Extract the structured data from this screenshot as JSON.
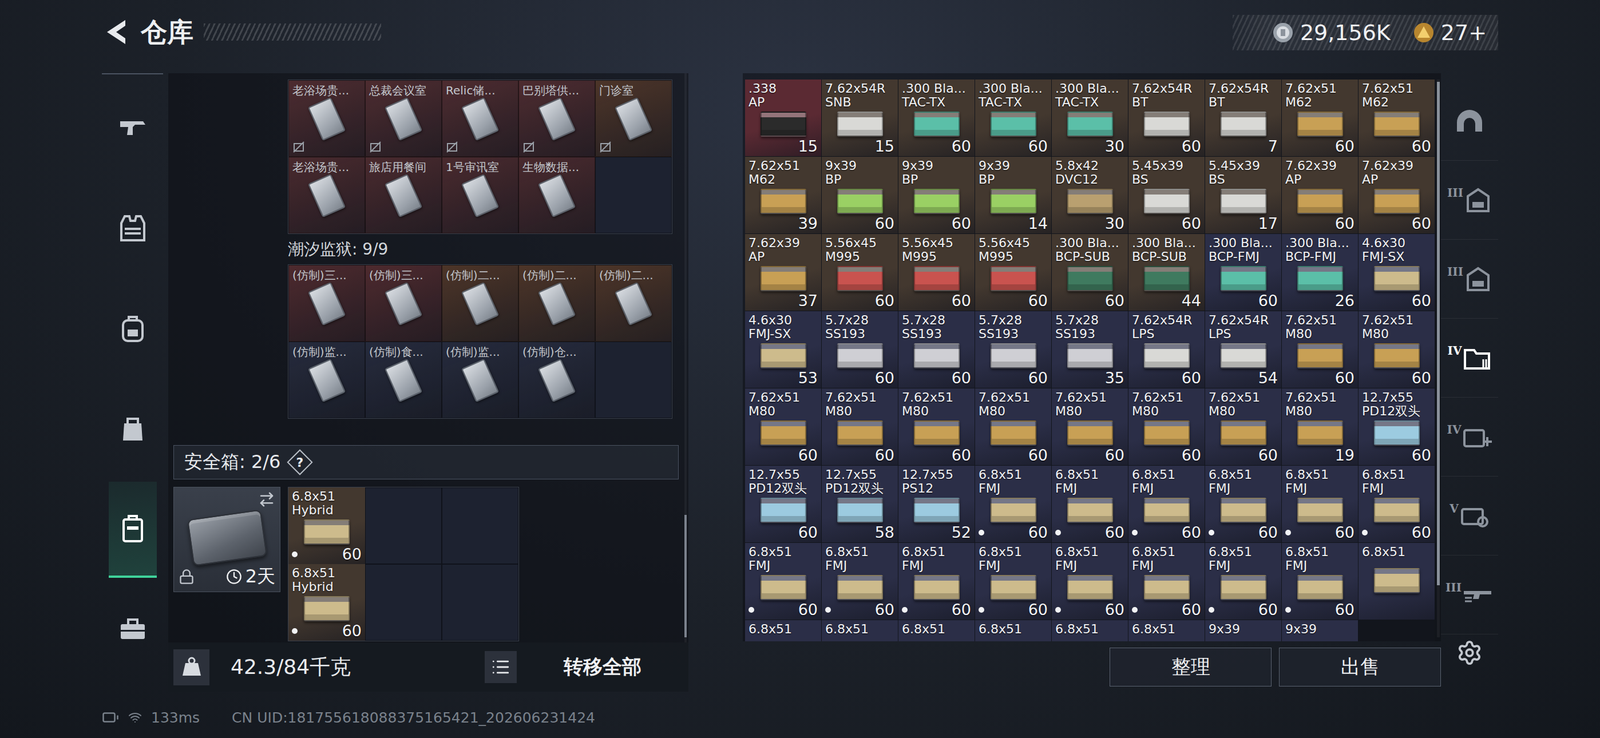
{
  "header": {
    "title": "仓库"
  },
  "currency": [
    {
      "kind": "silver",
      "value": "29,156K"
    },
    {
      "kind": "gold",
      "value": "27+"
    }
  ],
  "sidebar": {
    "items": [
      {
        "kind": "weapon",
        "selected": false
      },
      {
        "kind": "armor",
        "selected": false
      },
      {
        "kind": "backpack",
        "selected": false
      },
      {
        "kind": "pouch",
        "selected": false
      },
      {
        "kind": "case",
        "selected": true
      },
      {
        "kind": "toolbox",
        "selected": false
      }
    ]
  },
  "key_grid": {
    "cards": [
      {
        "label": "老浴场贵...",
        "color": "#4e2c30",
        "uninsured": true
      },
      {
        "label": "总裁会议室",
        "color": "#4e2c30",
        "uninsured": true
      },
      {
        "label": "Relic储...",
        "color": "#4e2c30",
        "uninsured": true
      },
      {
        "label": "巴别塔供...",
        "color": "#4e2c30",
        "uninsured": true
      },
      {
        "label": "门诊室",
        "color": "#4d3529",
        "uninsured": true
      },
      {
        "label": "老浴场贵...",
        "color": "#4a2a2e",
        "uninsured": false
      },
      {
        "label": "旅店用餐间",
        "color": "#4a2a2e",
        "uninsured": false
      },
      {
        "label": "1号审讯室",
        "color": "#4a2a2e",
        "uninsured": false
      },
      {
        "label": "生物数据...",
        "color": "#4a2a2e",
        "uninsured": false
      }
    ]
  },
  "key_section": {
    "title": "潮汐监狱: 9/9",
    "cards": [
      {
        "label": "(仿制)三...",
        "color": "#4e2a2e",
        "uninsured": false
      },
      {
        "label": "(仿制)三...",
        "color": "#4e2a2e",
        "uninsured": false
      },
      {
        "label": "(仿制)二...",
        "color": "#4d3528",
        "uninsured": false
      },
      {
        "label": "(仿制)二...",
        "color": "#4d3528",
        "uninsured": false
      },
      {
        "label": "(仿制)二...",
        "color": "#4d3528",
        "uninsured": false
      },
      {
        "label": "(仿制)监...",
        "color": "#262b3d",
        "uninsured": false
      },
      {
        "label": "(仿制)食...",
        "color": "#262b3d",
        "uninsured": false
      },
      {
        "label": "(仿制)监...",
        "color": "#262b3d",
        "uninsured": false
      },
      {
        "label": "(仿制)仓...",
        "color": "#262b3d",
        "uninsured": false
      }
    ]
  },
  "safe_box": {
    "title": "安全箱: 2/6",
    "help": "?",
    "case": {
      "timer": "2天",
      "locked": true
    },
    "items": [
      {
        "caliber": "6.8x51",
        "type": "Hybrid",
        "count": "60",
        "color": "#43382f",
        "box": "#cdbb8c",
        "dot": true
      },
      {
        "caliber": "6.8x51",
        "type": "Hybrid",
        "count": "60",
        "color": "#43382f",
        "box": "#cdbb8c",
        "dot": true
      }
    ]
  },
  "weight": {
    "text": "42.3/84千克"
  },
  "transfer_button": "转移全部",
  "ammo": [
    {
      "caliber": ".338",
      "type": "AP",
      "count": "15",
      "color": "#5b2a33",
      "box": "#2b2b2b",
      "dot": false
    },
    {
      "caliber": "7.62x54R",
      "type": "SNB",
      "count": "15",
      "color": "#43382f",
      "box": "#d9d9d6",
      "dot": false
    },
    {
      "caliber": ".300 Bla...",
      "type": "TAC-TX",
      "count": "60",
      "color": "#43382f",
      "box": "#5bbfa8",
      "dot": false
    },
    {
      "caliber": ".300 Bla...",
      "type": "TAC-TX",
      "count": "60",
      "color": "#43382f",
      "box": "#5bbfa8",
      "dot": false
    },
    {
      "caliber": ".300 Bla...",
      "type": "TAC-TX",
      "count": "30",
      "color": "#43382f",
      "box": "#5bbfa8",
      "dot": false
    },
    {
      "caliber": "7.62x54R",
      "type": "BT",
      "count": "60",
      "color": "#43382f",
      "box": "#d9d9d6",
      "dot": false
    },
    {
      "caliber": "7.62x54R",
      "type": "BT",
      "count": "7",
      "color": "#43382f",
      "box": "#d9d9d6",
      "dot": false
    },
    {
      "caliber": "7.62x51",
      "type": "M62",
      "count": "60",
      "color": "#43382f",
      "box": "#c8a055",
      "dot": false
    },
    {
      "caliber": "7.62x51",
      "type": "M62",
      "count": "60",
      "color": "#43382f",
      "box": "#c8a055",
      "dot": false
    },
    {
      "caliber": "7.62x51",
      "type": "M62",
      "count": "39",
      "color": "#43382f",
      "box": "#c8a055",
      "dot": false
    },
    {
      "caliber": "9x39",
      "type": "BP",
      "count": "60",
      "color": "#43382f",
      "box": "#9ad064",
      "dot": false
    },
    {
      "caliber": "9x39",
      "type": "BP",
      "count": "60",
      "color": "#43382f",
      "box": "#9ad064",
      "dot": false
    },
    {
      "caliber": "9x39",
      "type": "BP",
      "count": "14",
      "color": "#43382f",
      "box": "#9ad064",
      "dot": false
    },
    {
      "caliber": "5.8x42",
      "type": "DVC12",
      "count": "30",
      "color": "#43382f",
      "box": "#b9a070",
      "dot": false
    },
    {
      "caliber": "5.45x39",
      "type": "BS",
      "count": "60",
      "color": "#43382f",
      "box": "#d9d9d6",
      "dot": false
    },
    {
      "caliber": "5.45x39",
      "type": "BS",
      "count": "17",
      "color": "#43382f",
      "box": "#d9d9d6",
      "dot": false
    },
    {
      "caliber": "7.62x39",
      "type": "AP",
      "count": "60",
      "color": "#43382f",
      "box": "#c8a055",
      "dot": false
    },
    {
      "caliber": "7.62x39",
      "type": "AP",
      "count": "60",
      "color": "#43382f",
      "box": "#c8a055",
      "dot": false
    },
    {
      "caliber": "7.62x39",
      "type": "AP",
      "count": "37",
      "color": "#43382f",
      "box": "#c8a055",
      "dot": false
    },
    {
      "caliber": "5.56x45",
      "type": "M995",
      "count": "60",
      "color": "#43382f",
      "box": "#c9534f",
      "dot": false
    },
    {
      "caliber": "5.56x45",
      "type": "M995",
      "count": "60",
      "color": "#43382f",
      "box": "#c9534f",
      "dot": false
    },
    {
      "caliber": "5.56x45",
      "type": "M995",
      "count": "60",
      "color": "#43382f",
      "box": "#c9534f",
      "dot": false
    },
    {
      "caliber": ".300 Bla...",
      "type": "BCP-SUB",
      "count": "60",
      "color": "#43382f",
      "box": "#3f7a5f",
      "dot": false
    },
    {
      "caliber": ".300 Bla...",
      "type": "BCP-SUB",
      "count": "44",
      "color": "#43382f",
      "box": "#3f7a5f",
      "dot": false
    },
    {
      "caliber": ".300 Bla...",
      "type": "BCP-FMJ",
      "count": "60",
      "color": "#2b2e47",
      "box": "#5bbfa8",
      "dot": false
    },
    {
      "caliber": ".300 Bla...",
      "type": "BCP-FMJ",
      "count": "26",
      "color": "#2b2e47",
      "box": "#5bbfa8",
      "dot": false
    },
    {
      "caliber": "4.6x30",
      "type": "FMJ-SX",
      "count": "60",
      "color": "#2b2e47",
      "box": "#cdbb8c",
      "dot": false
    },
    {
      "caliber": "4.6x30",
      "type": "FMJ-SX",
      "count": "53",
      "color": "#2b2e47",
      "box": "#cdbb8c",
      "dot": false
    },
    {
      "caliber": "5.7x28",
      "type": "SS193",
      "count": "60",
      "color": "#2b2e47",
      "box": "#cfcfd4",
      "dot": false
    },
    {
      "caliber": "5.7x28",
      "type": "SS193",
      "count": "60",
      "color": "#2b2e47",
      "box": "#cfcfd4",
      "dot": false
    },
    {
      "caliber": "5.7x28",
      "type": "SS193",
      "count": "60",
      "color": "#2b2e47",
      "box": "#cfcfd4",
      "dot": false
    },
    {
      "caliber": "5.7x28",
      "type": "SS193",
      "count": "35",
      "color": "#2b2e47",
      "box": "#cfcfd4",
      "dot": false
    },
    {
      "caliber": "7.62x54R",
      "type": "LPS",
      "count": "60",
      "color": "#2b2e47",
      "box": "#d9d9d6",
      "dot": false
    },
    {
      "caliber": "7.62x54R",
      "type": "LPS",
      "count": "54",
      "color": "#2b2e47",
      "box": "#d9d9d6",
      "dot": false
    },
    {
      "caliber": "7.62x51",
      "type": "M80",
      "count": "60",
      "color": "#2b2e47",
      "box": "#c8a055",
      "dot": false
    },
    {
      "caliber": "7.62x51",
      "type": "M80",
      "count": "60",
      "color": "#2b2e47",
      "box": "#c8a055",
      "dot": false
    },
    {
      "caliber": "7.62x51",
      "type": "M80",
      "count": "60",
      "color": "#2b2e47",
      "box": "#c8a055",
      "dot": false
    },
    {
      "caliber": "7.62x51",
      "type": "M80",
      "count": "60",
      "color": "#2b2e47",
      "box": "#c8a055",
      "dot": false
    },
    {
      "caliber": "7.62x51",
      "type": "M80",
      "count": "60",
      "color": "#2b2e47",
      "box": "#c8a055",
      "dot": false
    },
    {
      "caliber": "7.62x51",
      "type": "M80",
      "count": "60",
      "color": "#2b2e47",
      "box": "#c8a055",
      "dot": false
    },
    {
      "caliber": "7.62x51",
      "type": "M80",
      "count": "60",
      "color": "#2b2e47",
      "box": "#c8a055",
      "dot": false
    },
    {
      "caliber": "7.62x51",
      "type": "M80",
      "count": "60",
      "color": "#2b2e47",
      "box": "#c8a055",
      "dot": false
    },
    {
      "caliber": "7.62x51",
      "type": "M80",
      "count": "60",
      "color": "#2b2e47",
      "box": "#c8a055",
      "dot": false
    },
    {
      "caliber": "7.62x51",
      "type": "M80",
      "count": "19",
      "color": "#2b2e47",
      "box": "#c8a055",
      "dot": false
    },
    {
      "caliber": "12.7x55",
      "type": "PD12双头",
      "count": "60",
      "color": "#2b2e47",
      "box": "#9ccbe0",
      "dot": false
    },
    {
      "caliber": "12.7x55",
      "type": "PD12双头",
      "count": "60",
      "color": "#2b2e47",
      "box": "#9ccbe0",
      "dot": false
    },
    {
      "caliber": "12.7x55",
      "type": "PD12双头",
      "count": "58",
      "color": "#2b2e47",
      "box": "#9ccbe0",
      "dot": false
    },
    {
      "caliber": "12.7x55",
      "type": "PS12",
      "count": "52",
      "color": "#2b2e47",
      "box": "#9ccbe0",
      "dot": false
    },
    {
      "caliber": "6.8x51",
      "type": "FMJ",
      "count": "60",
      "color": "#2b2e47",
      "box": "#cdbb8c",
      "dot": true
    },
    {
      "caliber": "6.8x51",
      "type": "FMJ",
      "count": "60",
      "color": "#2b2e47",
      "box": "#cdbb8c",
      "dot": true
    },
    {
      "caliber": "6.8x51",
      "type": "FMJ",
      "count": "60",
      "color": "#2b2e47",
      "box": "#cdbb8c",
      "dot": true
    },
    {
      "caliber": "6.8x51",
      "type": "FMJ",
      "count": "60",
      "color": "#2b2e47",
      "box": "#cdbb8c",
      "dot": true
    },
    {
      "caliber": "6.8x51",
      "type": "FMJ",
      "count": "60",
      "color": "#2b2e47",
      "box": "#cdbb8c",
      "dot": true
    },
    {
      "caliber": "6.8x51",
      "type": "FMJ",
      "count": "60",
      "color": "#2b2e47",
      "box": "#cdbb8c",
      "dot": true
    },
    {
      "caliber": "6.8x51",
      "type": "FMJ",
      "count": "60",
      "color": "#2b2e47",
      "box": "#cdbb8c",
      "dot": true
    },
    {
      "caliber": "6.8x51",
      "type": "FMJ",
      "count": "60",
      "color": "#2b2e47",
      "box": "#cdbb8c",
      "dot": true
    },
    {
      "caliber": "6.8x51",
      "type": "FMJ",
      "count": "60",
      "color": "#2b2e47",
      "box": "#cdbb8c",
      "dot": true
    },
    {
      "caliber": "6.8x51",
      "type": "FMJ",
      "count": "60",
      "color": "#2b2e47",
      "box": "#cdbb8c",
      "dot": true
    },
    {
      "caliber": "6.8x51",
      "type": "FMJ",
      "count": "60",
      "color": "#2b2e47",
      "box": "#cdbb8c",
      "dot": true
    },
    {
      "caliber": "6.8x51",
      "type": "FMJ",
      "count": "60",
      "color": "#2b2e47",
      "box": "#cdbb8c",
      "dot": true
    },
    {
      "caliber": "6.8x51",
      "type": "FMJ",
      "count": "60",
      "color": "#2b2e47",
      "box": "#cdbb8c",
      "dot": true
    },
    {
      "caliber": "6.8x51",
      "type": "FMJ",
      "count": "60",
      "color": "#2b2e47",
      "box": "#cdbb8c",
      "dot": true
    },
    {
      "caliber": "6.8x51",
      "color": "#2b2e47",
      "box": "#cdbb8c",
      "dot": false
    },
    {
      "caliber": "6.8x51",
      "color": "#2b2e47",
      "box": "#cdbb8c",
      "dot": false
    },
    {
      "caliber": "6.8x51",
      "color": "#2b2e47",
      "box": "#cdbb8c",
      "dot": false
    },
    {
      "caliber": "6.8x51",
      "color": "#2b2e47",
      "box": "#cdbb8c",
      "dot": false
    },
    {
      "caliber": "6.8x51",
      "color": "#2b2e47",
      "box": "#cdbb8c",
      "dot": false
    },
    {
      "caliber": "6.8x51",
      "color": "#2b2e47",
      "box": "#cdbb8c",
      "dot": false
    },
    {
      "caliber": "6.8x51",
      "color": "#2b2e47",
      "box": "#cdbb8c",
      "dot": false
    },
    {
      "caliber": "9x39",
      "color": "#2b2e47",
      "box": "#9ad064",
      "dot": false
    },
    {
      "caliber": "9x39",
      "color": "#2b2e47",
      "box": "#9ad064",
      "dot": false
    }
  ],
  "actions": [
    {
      "label": "整理"
    },
    {
      "label": "出售"
    }
  ],
  "right_nav": [
    {
      "kind": "helmet",
      "selected": false
    },
    {
      "kind": "rig",
      "tier": "III",
      "selected": false
    },
    {
      "kind": "rig",
      "tier": "III",
      "selected": false
    },
    {
      "kind": "folder",
      "tier": "IV",
      "selected": true
    },
    {
      "kind": "medical",
      "tier": "IV",
      "selected": false
    },
    {
      "kind": "tool",
      "tier": "V",
      "selected": false
    },
    {
      "kind": "weapon",
      "tier": "III",
      "selected": false
    }
  ],
  "footer": {
    "ping": "133ms",
    "uid": "CN UID:181755618088375165421_202606231424"
  }
}
